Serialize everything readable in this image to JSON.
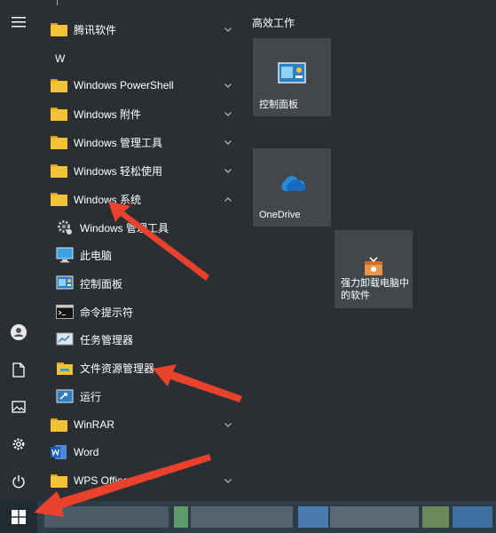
{
  "apps": {
    "tencent_folder": "腾讯软件",
    "letter_w": "W",
    "powershell_folder": "Windows PowerShell",
    "accessories_folder": "Windows 附件",
    "admin_tools_folder": "Windows 管理工具",
    "ease_folder": "Windows 轻松使用",
    "system_folder": "Windows 系统",
    "system_items": {
      "admin_tools": "Windows 管理工具",
      "this_pc": "此电脑",
      "control_panel": "控制面板",
      "cmd": "命令提示符",
      "task_manager": "任务管理器",
      "file_explorer": "文件资源管理器",
      "run": "运行"
    },
    "winrar_folder": "WinRAR",
    "word": "Word",
    "wps_folder": "WPS Office"
  },
  "tiles": {
    "group_title": "高效工作",
    "control_panel": "控制面板",
    "onedrive": "OneDrive",
    "uninstaller_line1": "强力卸载电脑中",
    "uninstaller_line2": "的软件"
  },
  "colors": {
    "background": "#2b2f33",
    "tile": "#43474b",
    "folder": "#f3c237",
    "arrow": "#e8412c",
    "taskbar": "#2e3c45"
  }
}
